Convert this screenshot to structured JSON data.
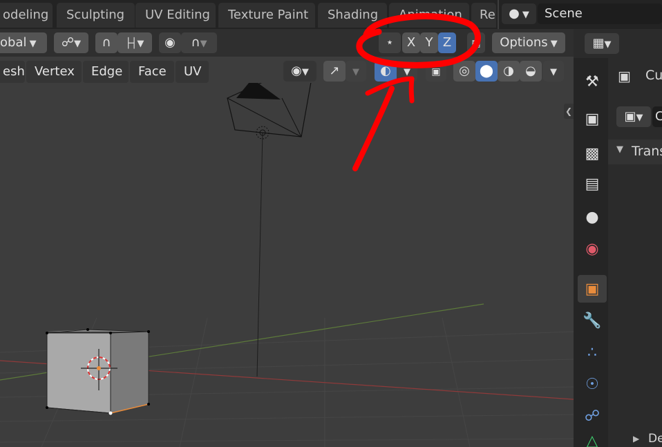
{
  "workspace_tabs": [
    "odeling",
    "Sculpting",
    "UV Editing",
    "Texture Paint",
    "Shading",
    "Animation",
    "Re"
  ],
  "scene": {
    "name": "Scene"
  },
  "header": {
    "orientation": "obal",
    "mirror_axes": [
      "X",
      "Y",
      "Z"
    ],
    "options_label": "Options"
  },
  "menus": [
    "esh",
    "Vertex",
    "Edge",
    "Face",
    "UV"
  ],
  "properties": {
    "object_name": "Cu",
    "object_name2": "C",
    "transform_label": "Trans",
    "delta_label": "De"
  },
  "colors": {
    "accent": "#4772b3",
    "annotation": "#ff0000",
    "active_icon": "#e98c3c"
  }
}
